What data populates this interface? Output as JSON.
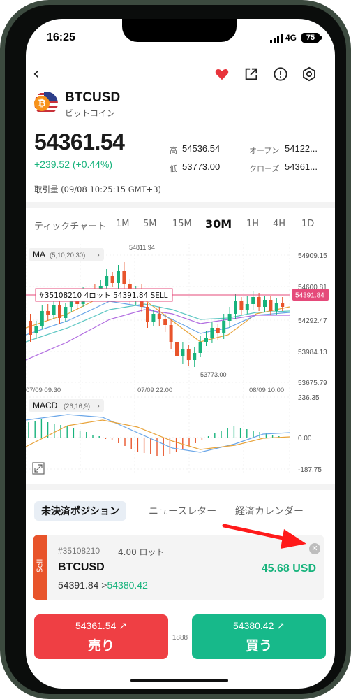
{
  "status": {
    "time": "16:25",
    "network": "4G",
    "battery": "75"
  },
  "instrument": {
    "symbol": "BTCUSD",
    "name": "ビットコイン"
  },
  "quote": {
    "price": "54361.54",
    "change": "+239.52 (+0.44%)",
    "high_label": "高",
    "high": "54536.54",
    "low_label": "低",
    "low": "53773.00",
    "open_label": "オープン",
    "open": "54122...",
    "close_label": "クローズ",
    "close": "54361...",
    "volume": "取引量 (09/08 10:25:15 GMT+3)"
  },
  "timeframes": [
    "ティックチャート",
    "1M",
    "5M",
    "15M",
    "30M",
    "1H",
    "4H",
    "1D"
  ],
  "active_timeframe": "30M",
  "chart": {
    "ma_label": "MA",
    "ma_params": "(5,10,20,30)",
    "macd_label": "MACD",
    "macd_params": "(26,16,9)",
    "price_axis": [
      "54909.15",
      "54600.81",
      "54292.47",
      "53984.13",
      "53675.79"
    ],
    "current_price_tag": "54391.84",
    "high_marker": "54811.94",
    "low_marker": "53773.00",
    "position_line": "#35108210 4ロット 54391.84 SELL",
    "time_axis": [
      "07/09 09:30",
      "07/09 22:00",
      "08/09 10:00"
    ],
    "macd_axis": [
      "236.35",
      "0.00",
      "-187.75"
    ],
    "colors": {
      "up": "#17b37c",
      "down": "#e8542b",
      "ma1": "#e8a33a",
      "ma2": "#6aa6e8",
      "ma3": "#b06be0",
      "ma4": "#5bc6c2"
    }
  },
  "tabs": [
    "未決済ポジション",
    "ニュースレター",
    "経済カレンダー"
  ],
  "position": {
    "side": "Sell",
    "id": "#35108210",
    "lots": "4.00 ロット",
    "symbol": "BTCUSD",
    "pnl": "45.68 USD",
    "open_price": "54391.84",
    "arrow": ">",
    "current_price": "54380.42"
  },
  "trade": {
    "sell_price": "54361.54",
    "sell_label": "売り",
    "buy_price": "54380.42",
    "buy_label": "買う",
    "spread": "1888"
  }
}
